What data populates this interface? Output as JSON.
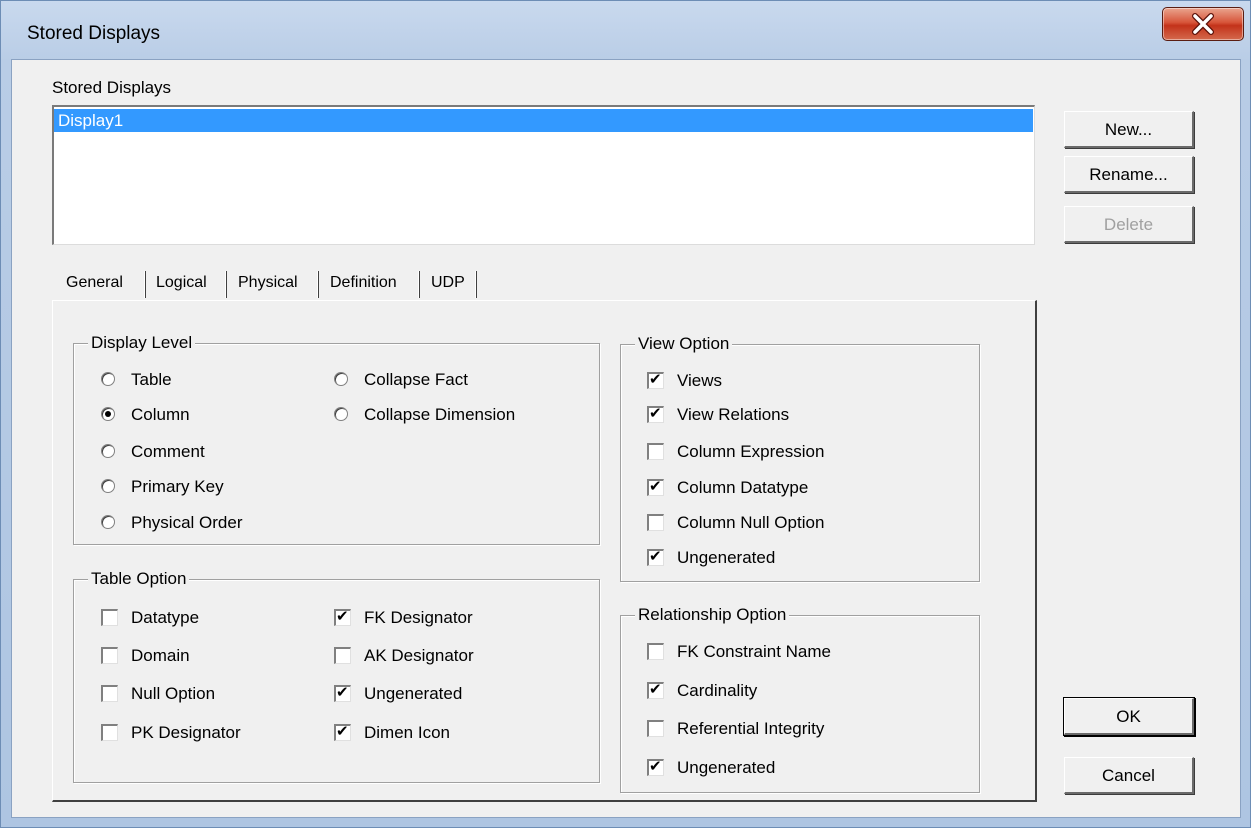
{
  "window": {
    "title": "Stored Displays"
  },
  "stored_displays": {
    "label": "Stored Displays",
    "items": [
      "Display1"
    ],
    "selected": "Display1"
  },
  "buttons": {
    "new": "New...",
    "rename": "Rename...",
    "delete": "Delete",
    "ok": "OK",
    "cancel": "Cancel"
  },
  "tabs": [
    "General",
    "Logical",
    "Physical",
    "Definition",
    "UDP"
  ],
  "active_tab": "Physical",
  "display_level": {
    "title": "Display Level",
    "options": [
      {
        "label": "Table",
        "checked": false
      },
      {
        "label": "Column",
        "checked": true
      },
      {
        "label": "Comment",
        "checked": false
      },
      {
        "label": "Primary Key",
        "checked": false
      },
      {
        "label": "Physical Order",
        "checked": false
      },
      {
        "label": "Collapse Fact",
        "checked": false
      },
      {
        "label": "Collapse Dimension",
        "checked": false
      }
    ]
  },
  "table_option": {
    "title": "Table Option",
    "options": [
      {
        "label": "Datatype",
        "checked": false
      },
      {
        "label": "Domain",
        "checked": false
      },
      {
        "label": "Null Option",
        "checked": false
      },
      {
        "label": "PK Designator",
        "checked": false
      },
      {
        "label": "FK Designator",
        "checked": true
      },
      {
        "label": "AK Designator",
        "checked": false
      },
      {
        "label": "Ungenerated",
        "checked": true
      },
      {
        "label": "Dimen Icon",
        "checked": true
      }
    ]
  },
  "view_option": {
    "title": "View Option",
    "options": [
      {
        "label": "Views",
        "checked": true
      },
      {
        "label": "View Relations",
        "checked": true
      },
      {
        "label": "Column Expression",
        "checked": false
      },
      {
        "label": "Column Datatype",
        "checked": true
      },
      {
        "label": "Column Null Option",
        "checked": false
      },
      {
        "label": "Ungenerated",
        "checked": true
      }
    ]
  },
  "relationship_option": {
    "title": "Relationship Option",
    "options": [
      {
        "label": "FK Constraint Name",
        "checked": false
      },
      {
        "label": "Cardinality",
        "checked": true
      },
      {
        "label": "Referential Integrity",
        "checked": false
      },
      {
        "label": "Ungenerated",
        "checked": true
      }
    ]
  },
  "icons": {
    "close": "close-icon",
    "check": "check-icon"
  }
}
